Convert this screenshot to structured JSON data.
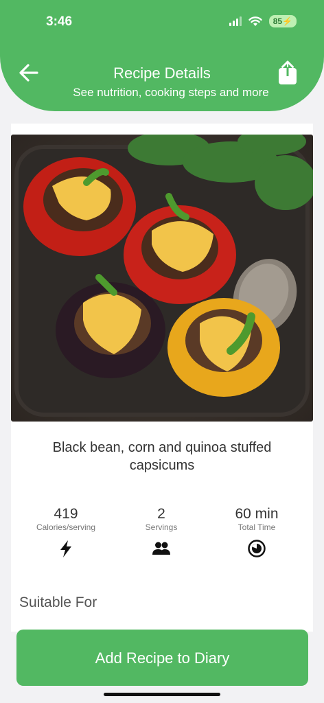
{
  "status_bar": {
    "time": "3:46",
    "battery": "85"
  },
  "header": {
    "title": "Recipe Details",
    "subtitle": "See nutrition, cooking steps and more",
    "back_icon": "arrow-left-icon",
    "share_icon": "share-icon"
  },
  "recipe": {
    "image": "stuffed-capsicums-photo",
    "title": "Black bean, corn and quinoa stuffed capsicums",
    "stats": [
      {
        "value": "419",
        "label": "Calories/serving",
        "icon": "lightning-icon"
      },
      {
        "value": "2",
        "label": "Servings",
        "icon": "people-icon"
      },
      {
        "value": "60 min",
        "label": "Total Time",
        "icon": "timer-icon"
      }
    ]
  },
  "sections": {
    "suitable_for": "Suitable For"
  },
  "actions": {
    "add_to_diary": "Add Recipe to Diary"
  },
  "colors": {
    "brand_green": "#52b862",
    "battery_badge": "#bff0b3"
  }
}
